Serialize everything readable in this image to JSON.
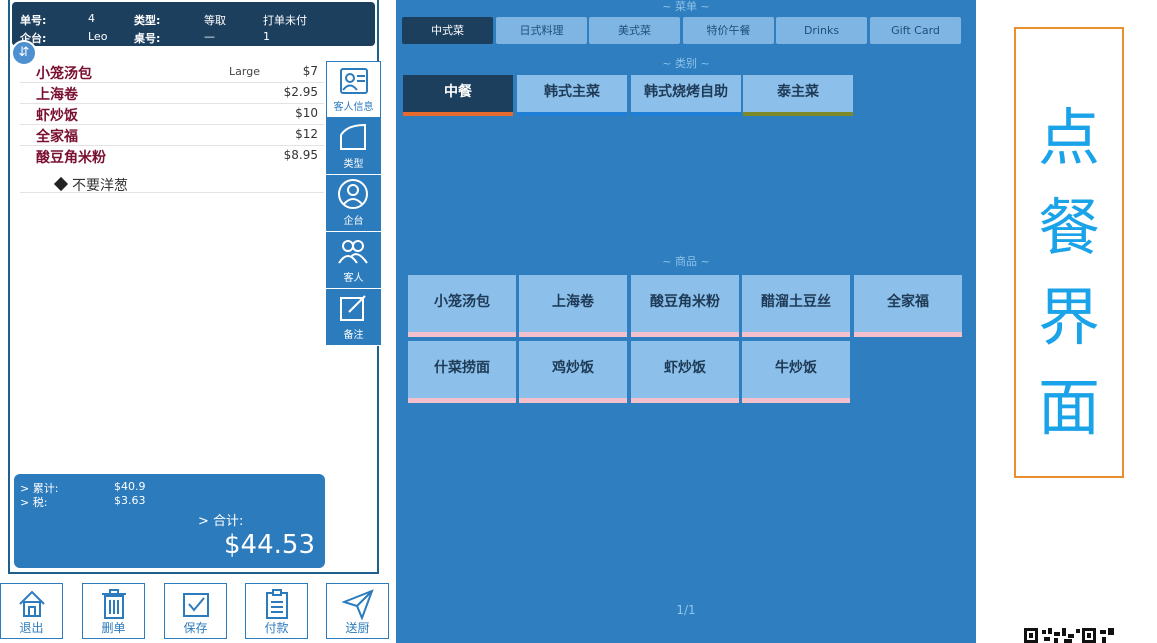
{
  "order_header": {
    "order_no_label": "单号:",
    "order_no": "4",
    "type_label": "类型:",
    "type": "等取",
    "print_status": "打单未付",
    "staff_label": "企台:",
    "staff": "Leo",
    "table_label": "桌号:",
    "table": "—",
    "guests": "1"
  },
  "order_items": [
    {
      "name": "小笼汤包",
      "size": "Large",
      "price": "$7"
    },
    {
      "name": "上海卷",
      "size": "",
      "price": "$2.95"
    },
    {
      "name": "虾炒饭",
      "size": "",
      "price": "$10"
    },
    {
      "name": "全家福",
      "size": "",
      "price": "$12"
    },
    {
      "name": "酸豆角米粉",
      "size": "",
      "price": "$8.95"
    }
  ],
  "order_note": "不要洋葱",
  "side_buttons": [
    "客人信息",
    "类型",
    "企台",
    "客人",
    "备注"
  ],
  "totals": {
    "subtotal_label": "> 累计:",
    "subtotal": "$40.9",
    "tax_label": "> 税:",
    "tax": "$3.63",
    "total_label": "> 合计:",
    "total": "$44.53"
  },
  "bottom_buttons": [
    "退出",
    "删单",
    "保存",
    "付款",
    "送厨"
  ],
  "menu_title": "~ 菜单 ~",
  "menu_tabs": [
    "中式菜",
    "日式料理",
    "美式菜",
    "特价午餐",
    "Drinks",
    "Gift Card"
  ],
  "category_title": "~ 类别 ~",
  "categories": [
    {
      "label": "中餐",
      "bar": "#e66a2c"
    },
    {
      "label": "韩式主菜",
      "bar": "#1f7fd6"
    },
    {
      "label": "韩式烧烤自助",
      "bar": "#1f7fd6"
    },
    {
      "label": "泰主菜",
      "bar": "#7d8a2a"
    }
  ],
  "items_title": "~ 商品 ~",
  "items": [
    "小笼汤包",
    "上海卷",
    "酸豆角米粉",
    "醋溜土豆丝",
    "全家福",
    "什菜捞面",
    "鸡炒饭",
    "虾炒饭",
    "牛炒饭"
  ],
  "pager": "1/1",
  "side_label": [
    "点",
    "餐",
    "界",
    "面"
  ],
  "colors": {
    "accent": "#2e7ec0",
    "dark": "#1d3f5e",
    "label": "#1aa3e8",
    "border": "#e8902f"
  }
}
